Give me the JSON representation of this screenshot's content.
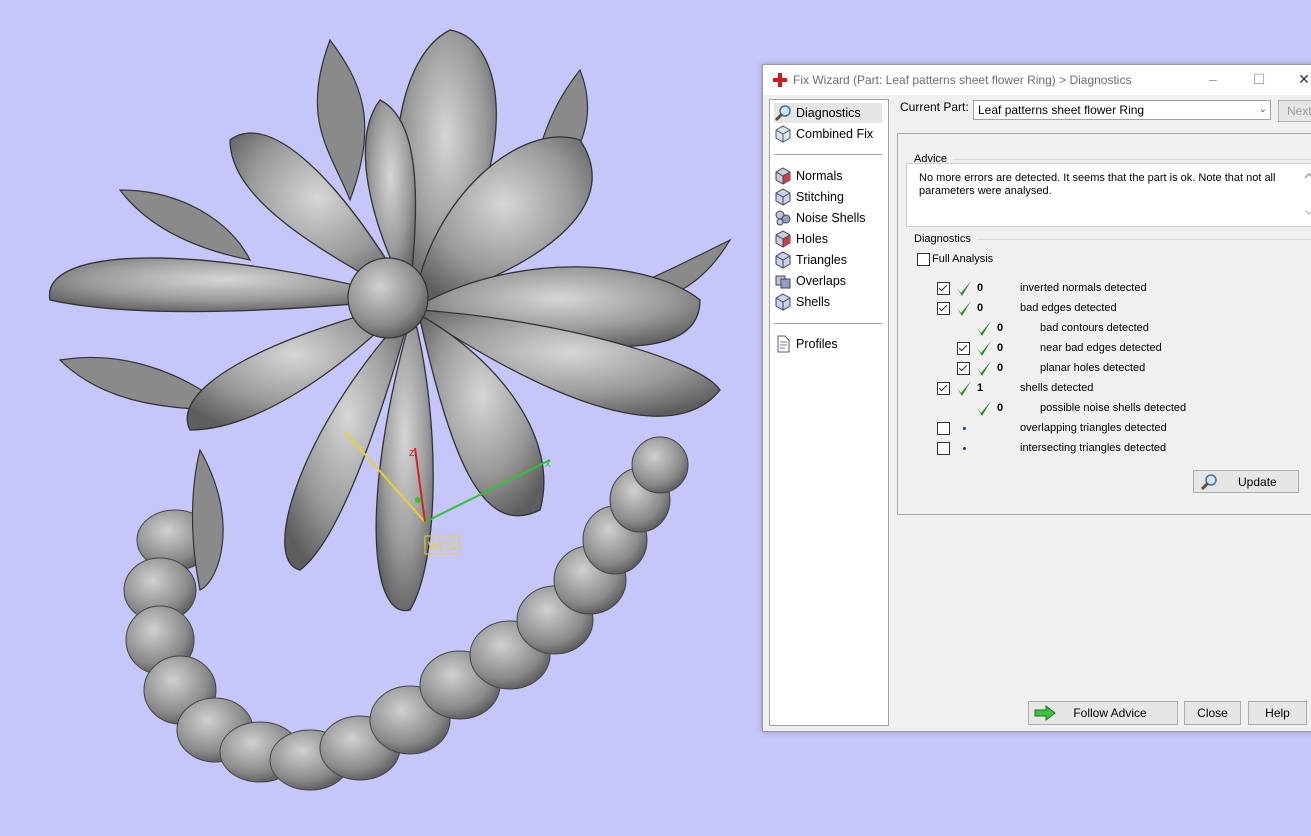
{
  "viewport": {
    "background": "#c6c6fb",
    "axis_labels": {
      "z": "z",
      "x": "x"
    },
    "wcs_label": "WCS"
  },
  "dialog": {
    "title": "Fix Wizard (Part: Leaf patterns sheet flower Ring) > Diagnostics",
    "title_icon": "red-cross-icon",
    "window_buttons": {
      "minimize": "–",
      "maximize": "☐",
      "close": "✕"
    }
  },
  "nav": {
    "top_items": [
      {
        "label": "Diagnostics",
        "icon": "magnifier-icon",
        "selected": true
      },
      {
        "label": "Combined Fix",
        "icon": "cube-icon",
        "selected": false
      }
    ],
    "fix_items": [
      {
        "label": "Normals",
        "icon": "cube-red-icon"
      },
      {
        "label": "Stitching",
        "icon": "cube-blue-icon"
      },
      {
        "label": "Noise Shells",
        "icon": "noise-icon"
      },
      {
        "label": "Holes",
        "icon": "cube-red-icon"
      },
      {
        "label": "Triangles",
        "icon": "cube-blue-icon"
      },
      {
        "label": "Overlaps",
        "icon": "overlap-icon"
      },
      {
        "label": "Shells",
        "icon": "cube-blue-icon"
      }
    ],
    "profiles": {
      "label": "Profiles",
      "icon": "document-icon"
    }
  },
  "current_part": {
    "label": "Current Part:",
    "value": "Leaf patterns sheet flower Ring",
    "next_label": "Next"
  },
  "advice": {
    "group_label": "Advice",
    "text": "No more errors are detected. It seems that the part is ok. Note that not all parameters were analysed."
  },
  "diagnostics": {
    "group_label": "Diagnostics",
    "full_analysis_label": "Full Analysis",
    "full_analysis_checked": false,
    "rows": [
      {
        "checkbox": true,
        "checked": true,
        "status": "ok",
        "count": "0",
        "label": "inverted normals detected",
        "indent": 0
      },
      {
        "checkbox": true,
        "checked": true,
        "status": "ok",
        "count": "0",
        "label": "bad edges detected",
        "indent": 0
      },
      {
        "checkbox": false,
        "checked": false,
        "status": "ok",
        "count": "0",
        "label": "bad contours detected",
        "indent": 1
      },
      {
        "checkbox": true,
        "checked": true,
        "status": "ok",
        "count": "0",
        "label": "near bad edges detected",
        "indent": 1
      },
      {
        "checkbox": true,
        "checked": true,
        "status": "ok",
        "count": "0",
        "label": "planar holes detected",
        "indent": 1
      },
      {
        "checkbox": true,
        "checked": true,
        "status": "ok",
        "count": "1",
        "label": "shells detected",
        "indent": 0
      },
      {
        "checkbox": false,
        "checked": false,
        "status": "ok",
        "count": "0",
        "label": "possible noise shells detected",
        "indent": 1
      },
      {
        "checkbox": true,
        "checked": false,
        "status": "pending",
        "count": "",
        "label": "overlapping triangles detected",
        "indent": 0
      },
      {
        "checkbox": true,
        "checked": false,
        "status": "pending",
        "count": "",
        "label": "intersecting triangles detected",
        "indent": 0
      }
    ],
    "update_label": "Update"
  },
  "buttons": {
    "follow_advice": "Follow Advice",
    "close": "Close",
    "help": "Help"
  },
  "colors": {
    "tick": "#2a8a2a",
    "pending_dot": "#1040c0",
    "model_gray": "#8c8c8c"
  }
}
